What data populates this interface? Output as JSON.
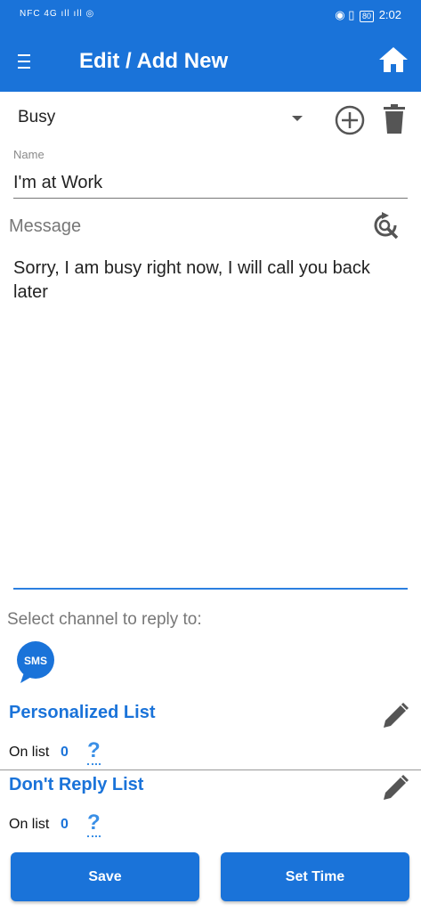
{
  "status_bar": {
    "left_text": "NFC 4G ıll ıll ◎",
    "battery": "80",
    "time": "2:02"
  },
  "app_bar": {
    "title": "Edit / Add New",
    "menu_icon": "hamburger-icon",
    "home_icon": "home-icon"
  },
  "type_selector": {
    "value": "Busy",
    "add_icon": "add-circle-icon",
    "delete_icon": "trash-icon"
  },
  "name_field": {
    "label": "Name",
    "value": "I'm at Work"
  },
  "message_field": {
    "label": "Message",
    "value": "Sorry, I am busy right now, I will call you back later",
    "icon": "refresh-search-icon"
  },
  "channel": {
    "label": "Select channel to reply to:",
    "sms_badge": "SMS"
  },
  "personalized_list": {
    "title": "Personalized List",
    "on_list_label": "On list",
    "count": "0",
    "help": "?"
  },
  "dont_reply_list": {
    "title": "Don't Reply List",
    "on_list_label": "On list",
    "count": "0",
    "help": "?"
  },
  "buttons": {
    "save": "Save",
    "set_time": "Set Time"
  },
  "colors": {
    "primary": "#1a73d9",
    "accent_line": "#2b7fe0"
  }
}
